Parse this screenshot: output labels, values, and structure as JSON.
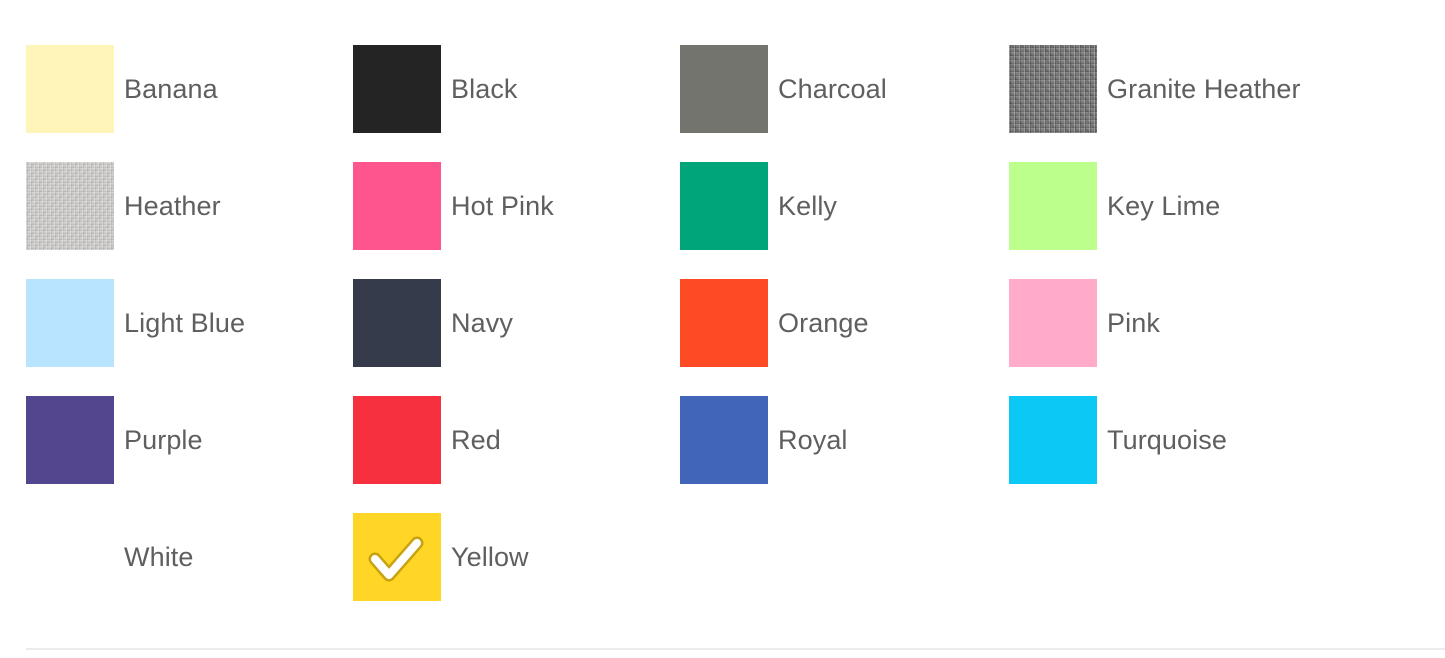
{
  "color_picker": {
    "selected": "Yellow",
    "options": [
      {
        "label": "Banana",
        "color": "#fff5b8",
        "texture": ""
      },
      {
        "label": "Black",
        "color": "#242424",
        "texture": ""
      },
      {
        "label": "Charcoal",
        "color": "#73746e",
        "texture": ""
      },
      {
        "label": "Granite Heather",
        "color": "#7c7c7c",
        "texture": "granite"
      },
      {
        "label": "Heather",
        "color": "#cfcdcb",
        "texture": "heather"
      },
      {
        "label": "Hot Pink",
        "color": "#ff558e",
        "texture": ""
      },
      {
        "label": "Kelly",
        "color": "#00a67a",
        "texture": ""
      },
      {
        "label": "Key Lime",
        "color": "#bdff8c",
        "texture": ""
      },
      {
        "label": "Light Blue",
        "color": "#b8e4ff",
        "texture": ""
      },
      {
        "label": "Navy",
        "color": "#363b4b",
        "texture": ""
      },
      {
        "label": "Orange",
        "color": "#ff4a26",
        "texture": ""
      },
      {
        "label": "Pink",
        "color": "#ffabc9",
        "texture": ""
      },
      {
        "label": "Purple",
        "color": "#53458e",
        "texture": ""
      },
      {
        "label": "Red",
        "color": "#f7303f",
        "texture": ""
      },
      {
        "label": "Royal",
        "color": "#4165b8",
        "texture": ""
      },
      {
        "label": "Turquoise",
        "color": "#0bc8f5",
        "texture": ""
      },
      {
        "label": "White",
        "color": "#ffffff",
        "texture": ""
      },
      {
        "label": "Yellow",
        "color": "#ffd526",
        "texture": ""
      }
    ]
  }
}
